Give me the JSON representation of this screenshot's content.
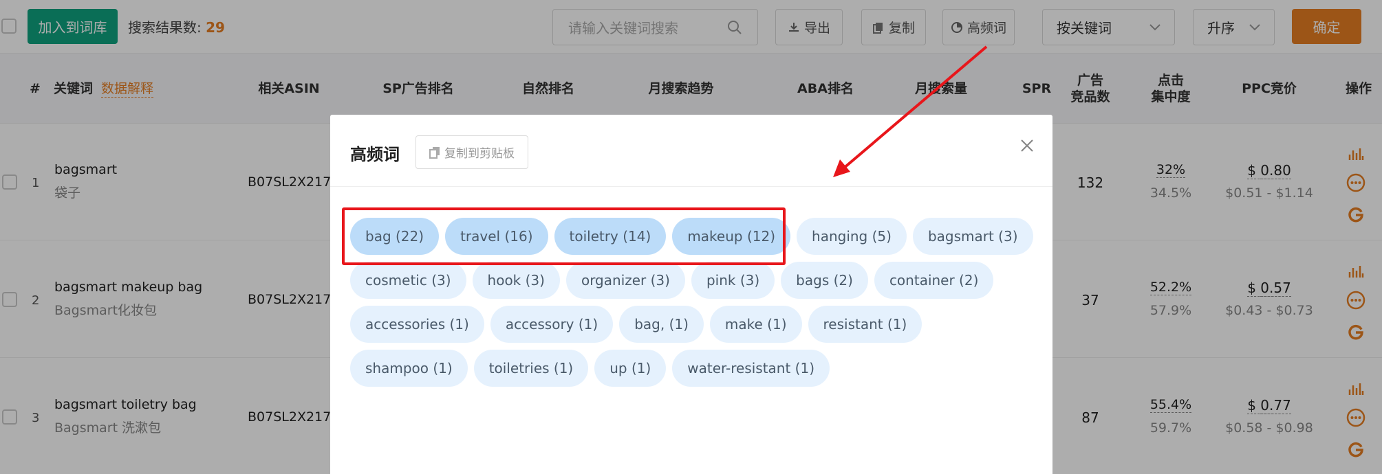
{
  "toolbar": {
    "add_label": "加入到词库",
    "result_label": "搜索结果数: ",
    "result_count": "29",
    "search_placeholder": "请输入关键词搜索",
    "export_label": "导出",
    "copy_label": "复制",
    "freq_label": "高频词",
    "sort_field": "按关键词",
    "sort_order": "升序",
    "confirm_label": "确定"
  },
  "table": {
    "headers": {
      "index": "#",
      "keyword": "关键词",
      "data_explain": "数据解释",
      "asin": "相关ASIN",
      "sp_rank": "SP广告排名",
      "natural_rank": "自然排名",
      "trend": "月搜索趋势",
      "aba": "ABA排名",
      "volume": "月搜索量",
      "spr": "SPR",
      "ad_products_1": "广告",
      "ad_products_2": "竞品数",
      "click_1": "点击",
      "click_2": "集中度",
      "ppc": "PPC竞价",
      "ops": "操作"
    },
    "rows": [
      {
        "index": "1",
        "keyword": "bagsmart",
        "translation": "袋子",
        "asin": "B07SL2X217",
        "ad_count": "132",
        "click_pct": "32%",
        "click_pct2": "34.5%",
        "ppc_currency": "$",
        "ppc": "0.80",
        "ppc_range": "$0.51 - $1.14"
      },
      {
        "index": "2",
        "keyword": "bagsmart makeup bag",
        "translation": "Bagsmart化妆包",
        "asin": "B07SL2X217",
        "ad_count": "37",
        "click_pct": "52.2%",
        "click_pct2": "57.9%",
        "ppc_currency": "$",
        "ppc": "0.57",
        "ppc_range": "$0.43 - $0.73"
      },
      {
        "index": "3",
        "keyword": "bagsmart toiletry bag",
        "translation": "Bagsmart 洗漱包",
        "asin": "B07SL2X217",
        "ad_count": "87",
        "click_pct": "55.4%",
        "click_pct2": "59.7%",
        "ppc_currency": "$",
        "ppc": "0.77",
        "ppc_range": "$0.58 - $0.98"
      }
    ]
  },
  "modal": {
    "title": "高频词",
    "copy_label": "复制到剪贴板",
    "tags": [
      "bag (22)",
      "travel (16)",
      "toiletry (14)",
      "makeup (12)",
      "hanging (5)",
      "bagsmart (3)",
      "cosmetic (3)",
      "hook (3)",
      "organizer (3)",
      "pink (3)",
      "bags (2)",
      "container (2)",
      "accessories (1)",
      "accessory (1)",
      "bag, (1)",
      "make (1)",
      "resistant (1)",
      "shampoo (1)",
      "toiletries (1)",
      "up (1)",
      "water-resistant (1)"
    ]
  },
  "colors": {
    "primary_green": "#10a37f",
    "accent_orange": "#e67e22",
    "tag_bg": "#e5f1fd",
    "tag_highlight_bg": "#bcdcf9",
    "annotation_red": "#e8161b"
  }
}
